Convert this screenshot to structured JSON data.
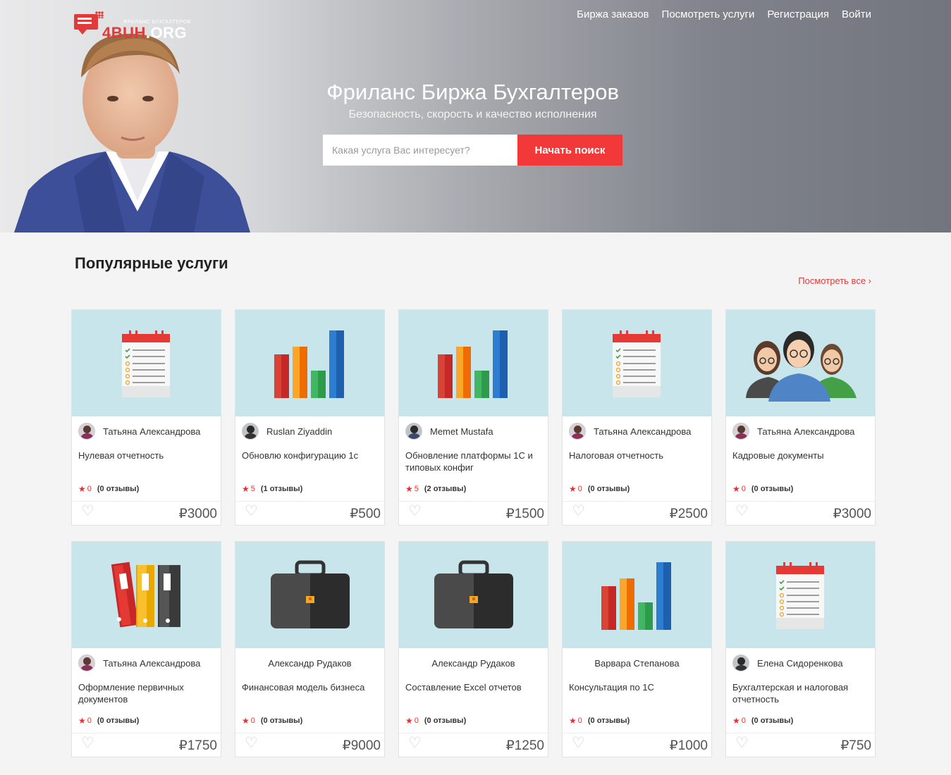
{
  "logo": {
    "text_red": "4BUH",
    "text_white": ".ORG",
    "tagline": "ФРИЛАНС БУХГАЛТЕРОВ"
  },
  "nav": [
    "Биржа заказов",
    "Посмотреть услуги",
    "Регистрация",
    "Войти"
  ],
  "hero": {
    "title": "Фриланс Биржа Бухгалтеров",
    "subtitle": "Безопасность, скорость и качество исполнения",
    "search_placeholder": "Какая услуга Вас интересует?",
    "search_button": "Начать поиск"
  },
  "section": {
    "title": "Популярные услуги",
    "view_all": "Посмотреть все ›"
  },
  "cards": [
    {
      "icon": "checklist-icon",
      "author": "Татьяна Александрова",
      "avatar": "woman",
      "title": "Нулевая отчетность",
      "rating": "0",
      "reviews": "(0 отзывы)",
      "price": "₽3000"
    },
    {
      "icon": "bar-chart-icon",
      "author": "Ruslan Ziyaddin",
      "avatar": "dark",
      "title": "Обновлю конфигурацию 1с",
      "rating": "5",
      "reviews": "(1 отзывы)",
      "price": "₽500"
    },
    {
      "icon": "bar-chart-icon",
      "author": "Memet Mustafa",
      "avatar": "blue",
      "title": "Обновление платформы 1С и типовых конфиг",
      "rating": "5",
      "reviews": "(2 отзывы)",
      "price": "₽1500"
    },
    {
      "icon": "checklist-icon",
      "author": "Татьяна Александрова",
      "avatar": "woman",
      "title": "Налоговая отчетность",
      "rating": "0",
      "reviews": "(0 отзывы)",
      "price": "₽2500"
    },
    {
      "icon": "team-icon",
      "author": "Татьяна Александрова",
      "avatar": "woman",
      "title": "Кадровые документы",
      "rating": "0",
      "reviews": "(0 отзывы)",
      "price": "₽3000"
    },
    {
      "icon": "binders-icon",
      "author": "Татьяна Александрова",
      "avatar": "woman",
      "title": "Оформление первичных документов",
      "rating": "0",
      "reviews": "(0 отзывы)",
      "price": "₽1750"
    },
    {
      "icon": "briefcase-icon",
      "author": "Александр Рудаков",
      "avatar": "",
      "title": "Финансовая модель бизнеса",
      "rating": "0",
      "reviews": "(0 отзывы)",
      "price": "₽9000"
    },
    {
      "icon": "briefcase-icon",
      "author": "Александр Рудаков",
      "avatar": "",
      "title": "Составление Excel отчетов",
      "rating": "0",
      "reviews": "(0 отзывы)",
      "price": "₽1250"
    },
    {
      "icon": "bar-chart-icon",
      "author": "Варвара Степанова",
      "avatar": "",
      "title": "Консультация по 1С",
      "rating": "0",
      "reviews": "(0 отзывы)",
      "price": "₽1000"
    },
    {
      "icon": "checklist-icon",
      "author": "Елена Сидоренкова",
      "avatar": "dark",
      "title": "Бухгалтерская и налоговая отчетность",
      "rating": "0",
      "reviews": "(0 отзывы)",
      "price": "₽750"
    }
  ],
  "colors": {
    "accent": "#f23838",
    "thumb_bg": "#c7e5ea",
    "star": "#e53030"
  }
}
